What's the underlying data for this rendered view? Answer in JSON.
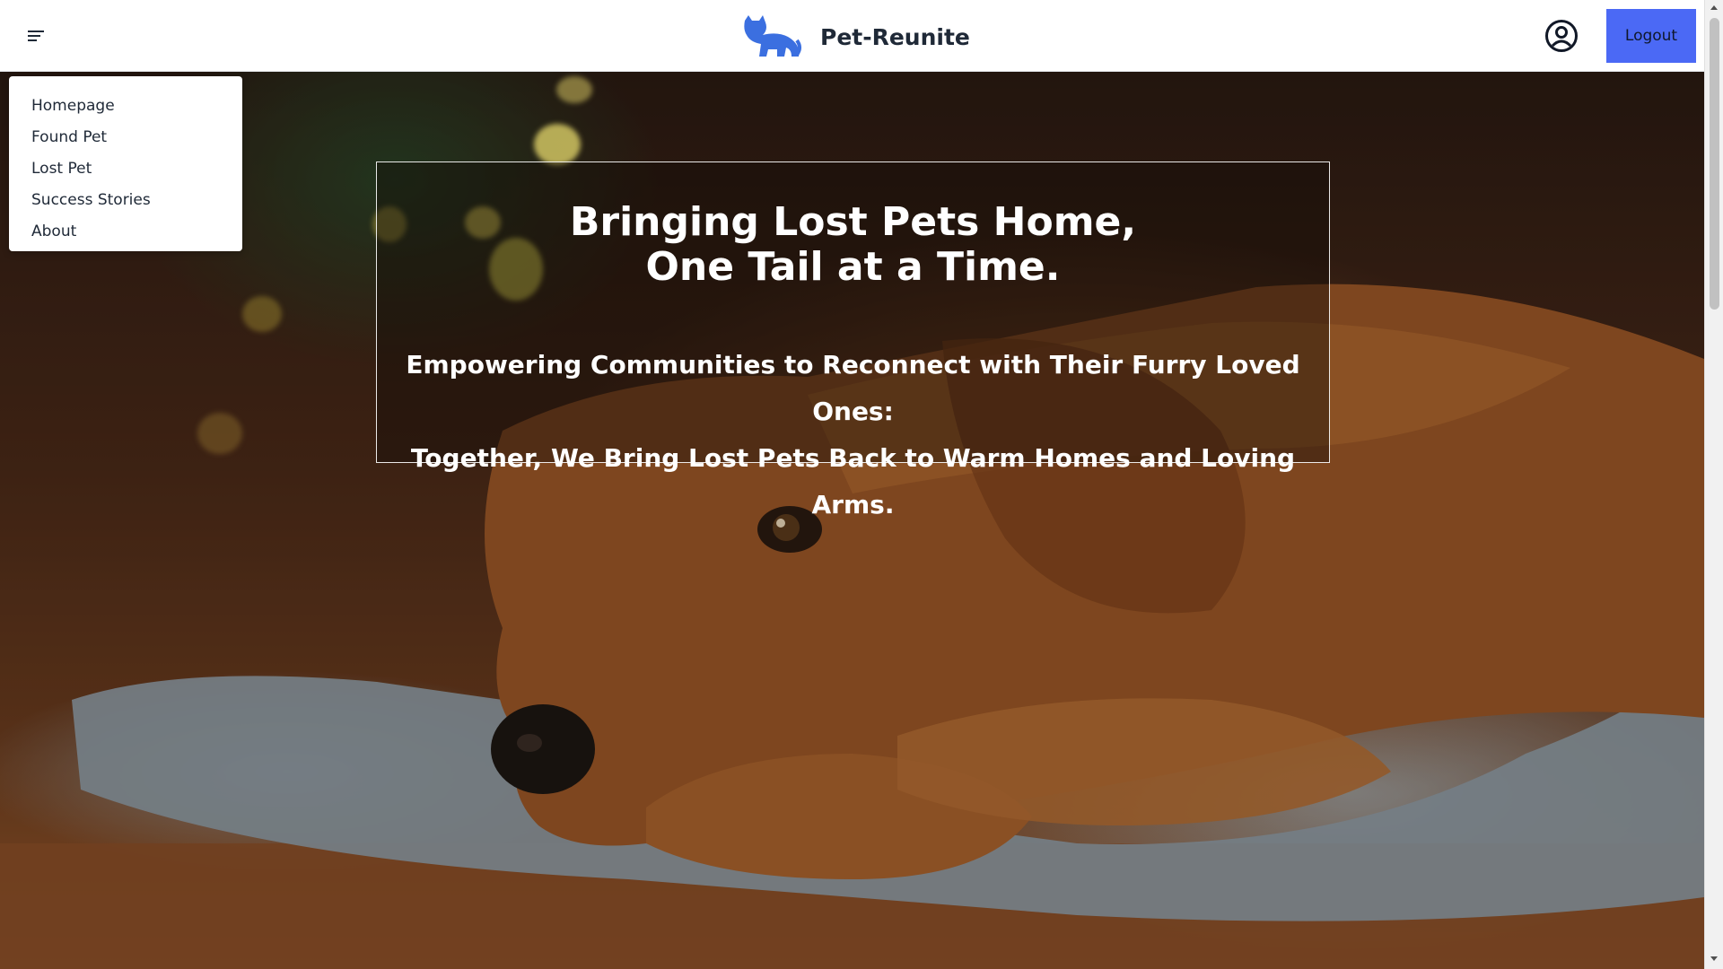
{
  "header": {
    "brand_name": "Pet-Reunite",
    "logout_label": "Logout",
    "brand_color": "#3b6fe0",
    "logout_color": "#4b69f5"
  },
  "menu": {
    "items": [
      {
        "label": "Homepage"
      },
      {
        "label": "Found Pet"
      },
      {
        "label": "Lost Pet"
      },
      {
        "label": "Success Stories"
      },
      {
        "label": "About"
      }
    ]
  },
  "hero": {
    "title_line1": "Bringing Lost Pets Home,",
    "title_line2": "One Tail at a Time.",
    "subtitle_line1": "Empowering Communities to Reconnect with Their Furry Loved Ones:",
    "subtitle_line2": "Together, We Bring Lost Pets Back to Warm Homes and Loving Arms."
  },
  "icons": {
    "menu": "hamburger-icon",
    "logo": "cat-logo-icon",
    "user": "user-circle-icon"
  }
}
